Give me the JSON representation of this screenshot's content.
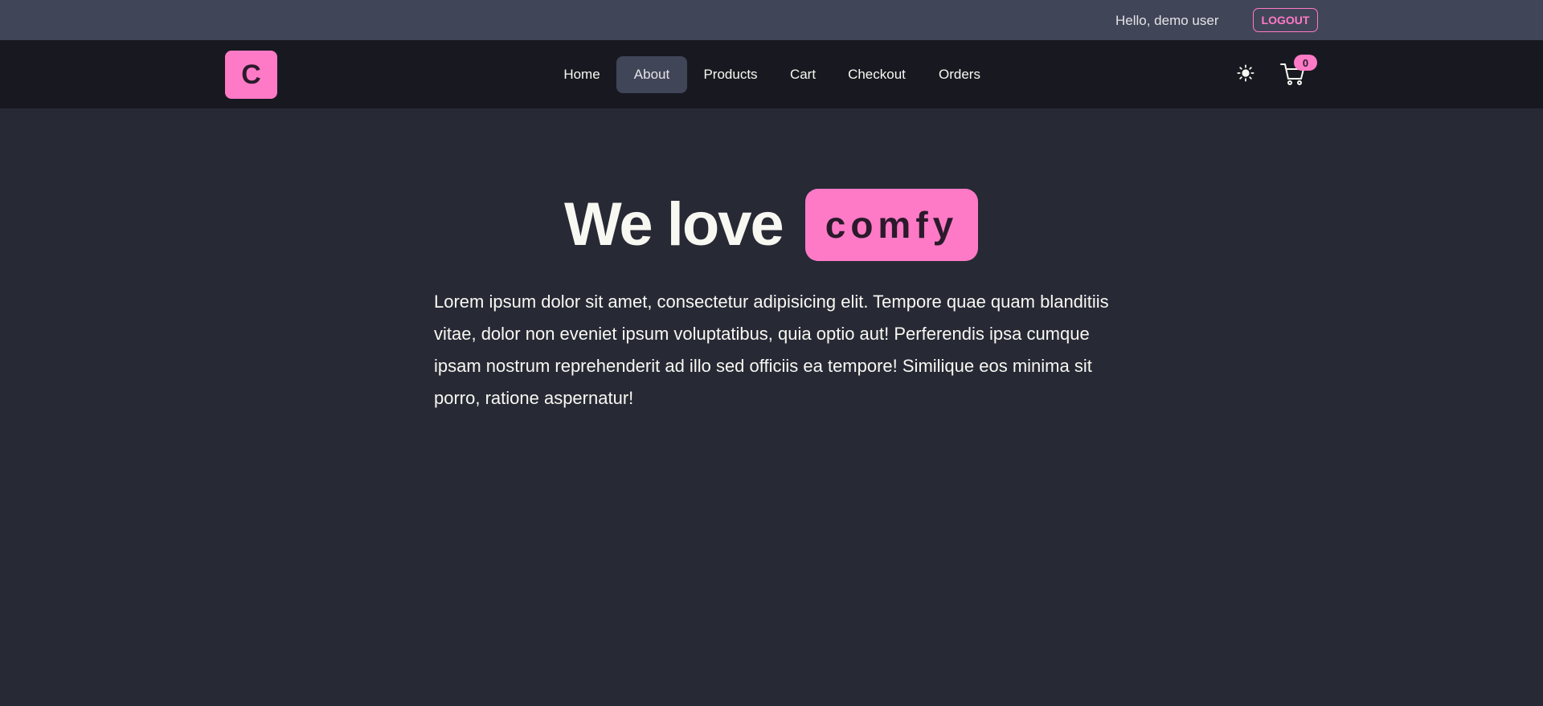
{
  "topbar": {
    "greeting": "Hello, demo user",
    "logout_label": "LOGOUT"
  },
  "navbar": {
    "logo_letter": "C",
    "links": [
      {
        "label": "Home",
        "active": false
      },
      {
        "label": "About",
        "active": true
      },
      {
        "label": "Products",
        "active": false
      },
      {
        "label": "Cart",
        "active": false
      },
      {
        "label": "Checkout",
        "active": false
      },
      {
        "label": "Orders",
        "active": false
      }
    ],
    "theme_icon": "sun-icon",
    "cart_icon": "shopping-cart-icon",
    "cart_count": "0"
  },
  "hero": {
    "title": "We love",
    "highlight": "comfy",
    "description": "Lorem ipsum dolor sit amet, consectetur adipisicing elit. Tempore quae quam blanditiis vitae, dolor non eveniet ipsum voluptatibus, quia optio aut! Perferendis ipsa cumque ipsam nostrum reprehenderit ad illo sed officiis ea tempore! Similique eos minima sit porro, ratione aspernatur!"
  },
  "colors": {
    "accent": "#ff7ac6",
    "topbar_bg": "#414558",
    "navbar_bg": "#181920",
    "page_bg": "#272935"
  }
}
